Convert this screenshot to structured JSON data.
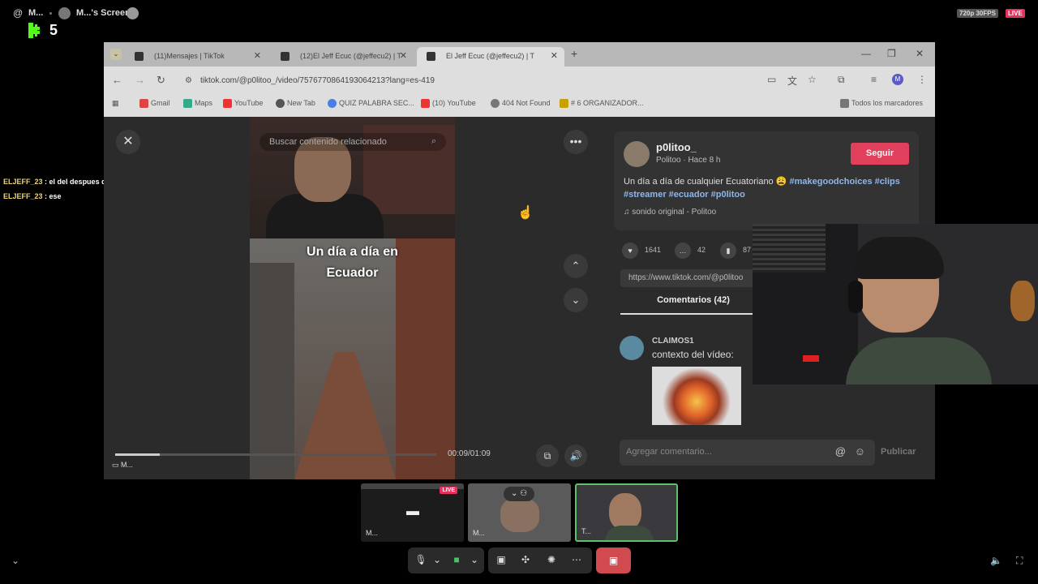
{
  "stream": {
    "at_icon": "@",
    "user_short": "M...",
    "screen_title": "M...'s Screen",
    "quality": "720p 30FPS",
    "live": "LIVE",
    "viewer_count": "5"
  },
  "chat": [
    {
      "user": "ELJEFF_23",
      "text": ": el del despues del pou"
    },
    {
      "user": "ELJEFF_23",
      "text": ": ese"
    }
  ],
  "browser": {
    "tabs": [
      {
        "label": "(11)Mensajes | TikTok"
      },
      {
        "label": "(12)El Jeff Ecuc (@jeffecu2) | T"
      },
      {
        "label": "El Jeff Ecuc (@jeffecu2) | T"
      }
    ],
    "url": "tiktok.com/@p0litoo_/video/7576770864193064213?lang=es-419",
    "bookmarks": [
      "Gmail",
      "Maps",
      "YouTube",
      "New Tab",
      "QUIZ PALABRA SEC...",
      "(10) YouTube",
      "404 Not Found",
      "# 6 ORGANIZADOR..."
    ],
    "all_bookmarks": "Todos los marcadores"
  },
  "video": {
    "search_placeholder": "Buscar contenido relacionado",
    "caption_line1": "Un día a día en",
    "caption_line2": "Ecuador",
    "time": "00:09/01:09",
    "progress": 0.14,
    "tile_label": "M..."
  },
  "post": {
    "username": "p0litoo_",
    "subline": "Politoo · Hace 8 h",
    "follow": "Seguir",
    "desc_text": "Un día a día de cualquier Ecuatoriano 😩",
    "tags": [
      "#makegoodchoices",
      "#clips",
      "#streamer",
      "#ecuador",
      "#p0litoo"
    ],
    "sound": "sonido original - Politoo",
    "likes": "1641",
    "comments_count": "42",
    "saves": "87",
    "link": "https://www.tiktok.com/@p0litoo",
    "comments_tab": "Comentarios (42)",
    "comment_user": "CLAIMOS1",
    "comment_text": "contexto del vídeo:",
    "comment_placeholder": "Agregar comentario...",
    "publish": "Publicar"
  },
  "tiles": [
    {
      "label": "M...",
      "live": "LIVE"
    },
    {
      "label": "M..."
    },
    {
      "label": "T..."
    }
  ],
  "colors": {
    "accent_green": "#53fc18",
    "live_pink": "#e8305c",
    "follow_red": "#e0405c",
    "end_red": "#d14a4f"
  }
}
